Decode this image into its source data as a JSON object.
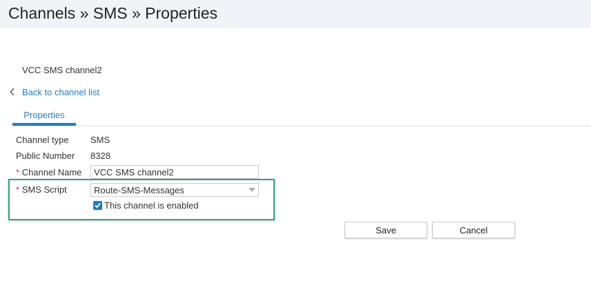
{
  "header": {
    "title": "Channels » SMS » Properties"
  },
  "channel": {
    "name_heading": "VCC SMS channel2"
  },
  "nav": {
    "back_label": "Back to channel list"
  },
  "tabs": [
    {
      "label": "Properties",
      "active": true
    }
  ],
  "form": {
    "channel_type_label": "Channel type",
    "channel_type_value": "SMS",
    "public_number_label": "Public Number",
    "public_number_value": "8328",
    "required_marker": "*",
    "channel_name_label": "Channel Name",
    "channel_name_value": "VCC SMS channel2",
    "sms_script_label": "SMS Script",
    "sms_script_value": "Route-SMS-Messages",
    "enabled_label": "This channel is enabled",
    "enabled_checked": true
  },
  "actions": {
    "save_label": "Save",
    "cancel_label": "Cancel"
  },
  "colors": {
    "header_bg": "#f0f3f7",
    "link": "#1f7ec4",
    "required": "#d9342b",
    "highlight": "#2aa57f"
  }
}
